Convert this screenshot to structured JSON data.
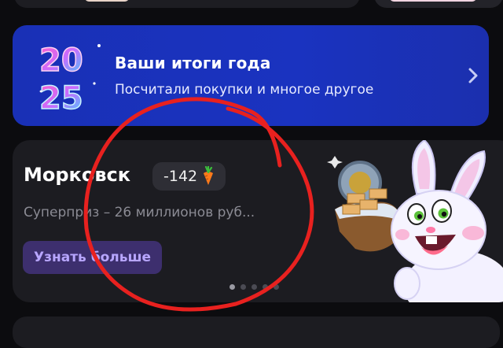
{
  "year_banner": {
    "badge_text": "2025",
    "title": "Ваши итоги года",
    "subtitle": "Посчитали покупки и многое другое"
  },
  "promo": {
    "title": "Морковск",
    "counter": "-142",
    "counter_icon": "carrot-icon",
    "subtitle": "Суперприз – 26 миллионов руб...",
    "button_label": "Узнать больше",
    "pager": {
      "count": 5,
      "active_index": 0
    }
  },
  "colors": {
    "banner_blue": "#1a2fb0",
    "card_bg": "#1c1c21",
    "button_bg": "#3d2f6e",
    "button_text": "#b8a6ff",
    "scribble_red": "#e8211f"
  }
}
